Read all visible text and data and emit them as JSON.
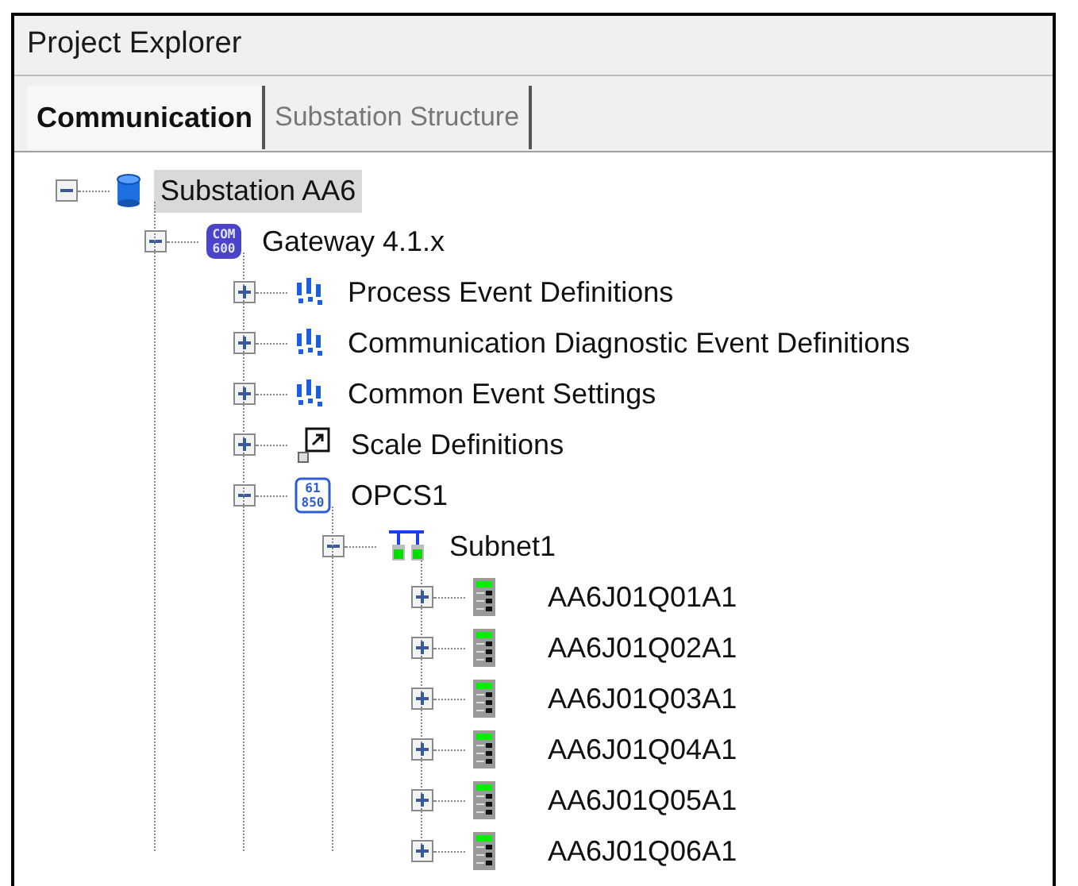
{
  "panel": {
    "title": "Project Explorer"
  },
  "tabs": [
    {
      "label": "Communication",
      "selected": true
    },
    {
      "label": "Substation Structure",
      "selected": false
    }
  ],
  "tree": [
    {
      "label": "Substation AA6",
      "kind": "database",
      "expanded": true,
      "selected": true,
      "children": [
        {
          "label": "Gateway 4.1.x",
          "kind": "gateway",
          "icon_text": [
            "COM",
            "600"
          ],
          "expanded": true,
          "selected": false,
          "children": [
            {
              "label": "Process Event Definitions",
              "kind": "events",
              "expanded": false,
              "selected": false
            },
            {
              "label": "Communication Diagnostic Event Definitions",
              "kind": "events",
              "expanded": false,
              "selected": false
            },
            {
              "label": "Common Event Settings",
              "kind": "events",
              "expanded": false,
              "selected": false
            },
            {
              "label": "Scale Definitions",
              "kind": "scale",
              "expanded": false,
              "selected": false
            },
            {
              "label": "OPCS1",
              "kind": "protocol",
              "icon_text": [
                "61",
                "850"
              ],
              "expanded": true,
              "selected": false,
              "children": [
                {
                  "label": "Subnet1",
                  "kind": "subnet",
                  "expanded": true,
                  "selected": false,
                  "children": [
                    {
                      "label": "AA6J01Q01A1",
                      "kind": "device",
                      "expanded": false,
                      "selected": false
                    },
                    {
                      "label": "AA6J01Q02A1",
                      "kind": "device",
                      "expanded": false,
                      "selected": false
                    },
                    {
                      "label": "AA6J01Q03A1",
                      "kind": "device",
                      "expanded": false,
                      "selected": false
                    },
                    {
                      "label": "AA6J01Q04A1",
                      "kind": "device",
                      "expanded": false,
                      "selected": false
                    },
                    {
                      "label": "AA6J01Q05A1",
                      "kind": "device",
                      "expanded": false,
                      "selected": false
                    },
                    {
                      "label": "AA6J01Q06A1",
                      "kind": "device",
                      "expanded": false,
                      "selected": false
                    }
                  ]
                }
              ]
            }
          ]
        }
      ]
    }
  ]
}
